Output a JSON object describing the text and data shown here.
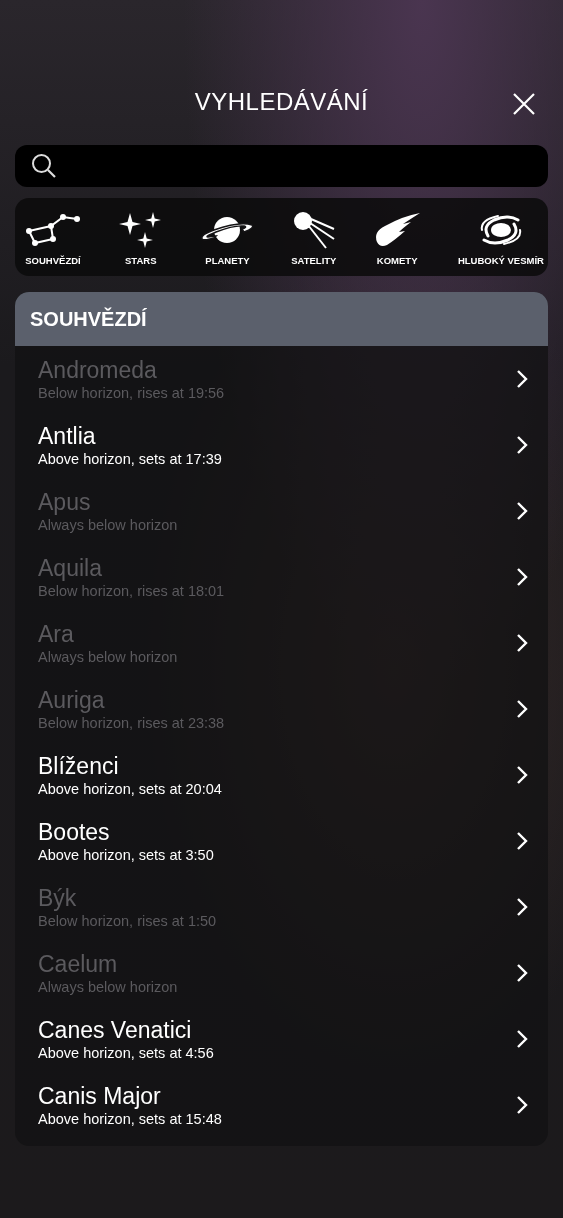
{
  "title": "VYHLEDÁVÁNÍ",
  "categories": [
    {
      "kind": "constellation",
      "label": "SOUHVĚZDÍ"
    },
    {
      "kind": "stars",
      "label": "STARS"
    },
    {
      "kind": "planet",
      "label": "PLANETY"
    },
    {
      "kind": "satellite",
      "label": "SATELITY"
    },
    {
      "kind": "comet",
      "label": "KOMETY"
    },
    {
      "kind": "galaxy",
      "label": "HLUBOKÝ VESMÍR"
    }
  ],
  "section": {
    "title": "SOUHVĚZDÍ",
    "items": [
      {
        "name": "Andromeda",
        "status": "Below horizon, rises at 19:56",
        "dimmed": true
      },
      {
        "name": "Antlia",
        "status": "Above horizon, sets at 17:39",
        "dimmed": false
      },
      {
        "name": "Apus",
        "status": "Always below horizon",
        "dimmed": true
      },
      {
        "name": "Aquila",
        "status": "Below horizon, rises at 18:01",
        "dimmed": true
      },
      {
        "name": "Ara",
        "status": "Always below horizon",
        "dimmed": true
      },
      {
        "name": "Auriga",
        "status": "Below horizon, rises at 23:38",
        "dimmed": true
      },
      {
        "name": "Blíženci",
        "status": "Above horizon, sets at 20:04",
        "dimmed": false
      },
      {
        "name": "Bootes",
        "status": "Above horizon, sets at 3:50",
        "dimmed": false
      },
      {
        "name": "Býk",
        "status": "Below horizon, rises at 1:50",
        "dimmed": true
      },
      {
        "name": "Caelum",
        "status": "Always below horizon",
        "dimmed": true
      },
      {
        "name": "Canes Venatici",
        "status": "Above horizon, sets at 4:56",
        "dimmed": false
      },
      {
        "name": "Canis Major",
        "status": "Above horizon, sets at 15:48",
        "dimmed": false
      }
    ]
  }
}
